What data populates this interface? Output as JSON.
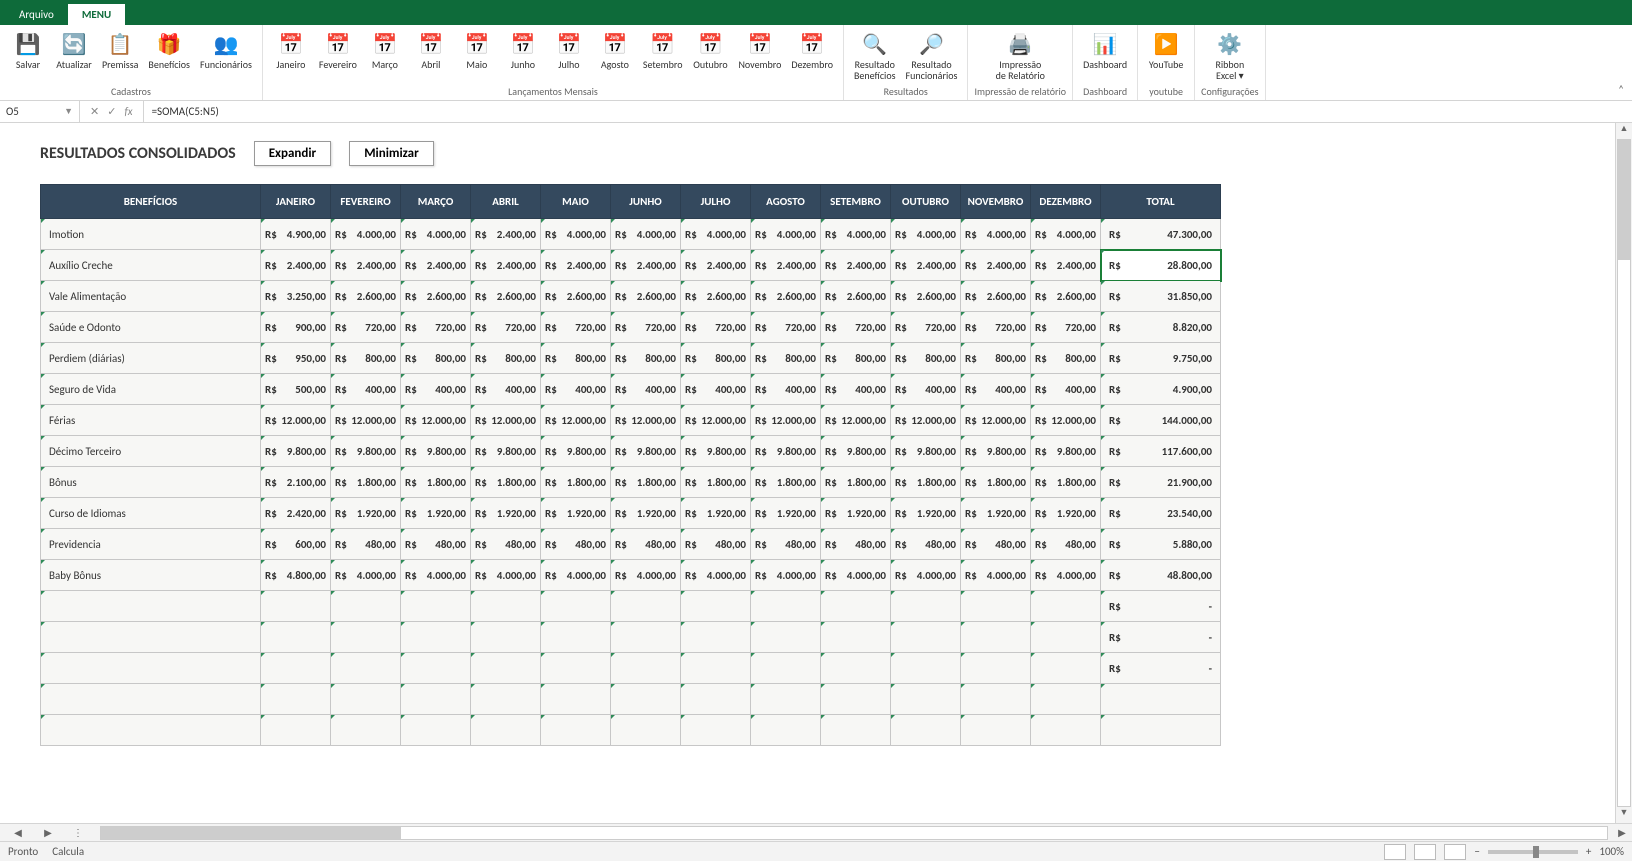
{
  "tabs": {
    "file": "Arquivo",
    "menu": "MENU"
  },
  "ribbon": {
    "groups": [
      {
        "label": "Cadastros",
        "buttons": [
          {
            "name": "salvar-button",
            "icon": "💾",
            "label": "Salvar"
          },
          {
            "name": "atualizar-button",
            "icon": "🔄",
            "label": "Atualizar"
          },
          {
            "name": "premissa-button",
            "icon": "📋",
            "label": "Premissa"
          },
          {
            "name": "beneficios-button",
            "icon": "🎁",
            "label": "Benefícios"
          },
          {
            "name": "funcionarios-button",
            "icon": "👥",
            "label": "Funcionários"
          }
        ]
      },
      {
        "label": "Lançamentos Mensais",
        "buttons": [
          {
            "name": "mes-janeiro",
            "icon": "📅",
            "label": "Janeiro"
          },
          {
            "name": "mes-fevereiro",
            "icon": "📅",
            "label": "Fevereiro"
          },
          {
            "name": "mes-marco",
            "icon": "📅",
            "label": "Março"
          },
          {
            "name": "mes-abril",
            "icon": "📅",
            "label": "Abril"
          },
          {
            "name": "mes-maio",
            "icon": "📅",
            "label": "Maio"
          },
          {
            "name": "mes-junho",
            "icon": "📅",
            "label": "Junho"
          },
          {
            "name": "mes-julho",
            "icon": "📅",
            "label": "Julho"
          },
          {
            "name": "mes-agosto",
            "icon": "📅",
            "label": "Agosto"
          },
          {
            "name": "mes-setembro",
            "icon": "📅",
            "label": "Setembro"
          },
          {
            "name": "mes-outubro",
            "icon": "📅",
            "label": "Outubro"
          },
          {
            "name": "mes-novembro",
            "icon": "📅",
            "label": "Novembro"
          },
          {
            "name": "mes-dezembro",
            "icon": "📅",
            "label": "Dezembro"
          }
        ]
      },
      {
        "label": "Resultados",
        "buttons": [
          {
            "name": "res-beneficios",
            "icon": "🔍",
            "label": "Resultado\nBenefícios"
          },
          {
            "name": "res-funcionarios",
            "icon": "🔎",
            "label": "Resultado\nFuncionários"
          }
        ]
      },
      {
        "label": "Impressão de relatório",
        "buttons": [
          {
            "name": "impressao",
            "icon": "🖨️",
            "label": "Impressão\nde Relatório"
          }
        ]
      },
      {
        "label": "Dashboard",
        "buttons": [
          {
            "name": "dashboard",
            "icon": "📊",
            "label": "Dashboard"
          }
        ]
      },
      {
        "label": "youtube",
        "buttons": [
          {
            "name": "youtube",
            "icon": "▶️",
            "label": "YouTube"
          }
        ]
      },
      {
        "label": "Configurações",
        "buttons": [
          {
            "name": "ribbon-excel",
            "icon": "⚙️",
            "label": "Ribbon\nExcel ▾"
          }
        ]
      }
    ]
  },
  "formula_bar": {
    "name_box": "O5",
    "formula": "=SOMA(C5:N5)"
  },
  "page": {
    "title": "RESULTADOS CONSOLIDADOS",
    "expand": "Expandir",
    "minimize": "Minimizar"
  },
  "table": {
    "currency": "R$",
    "headers": [
      "BENEFÍCIOS",
      "JANEIRO",
      "FEVEREIRO",
      "MARÇO",
      "ABRIL",
      "MAIO",
      "JUNHO",
      "JULHO",
      "AGOSTO",
      "SETEMBRO",
      "OUTUBRO",
      "NOVEMBRO",
      "DEZEMBRO",
      "TOTAL"
    ],
    "rows": [
      {
        "name": "Imotion",
        "m": [
          "4.900,00",
          "4.000,00",
          "4.000,00",
          "2.400,00",
          "4.000,00",
          "4.000,00",
          "4.000,00",
          "4.000,00",
          "4.000,00",
          "4.000,00",
          "4.000,00",
          "4.000,00"
        ],
        "total": "47.300,00"
      },
      {
        "name": "Auxílio Creche",
        "m": [
          "2.400,00",
          "2.400,00",
          "2.400,00",
          "2.400,00",
          "2.400,00",
          "2.400,00",
          "2.400,00",
          "2.400,00",
          "2.400,00",
          "2.400,00",
          "2.400,00",
          "2.400,00"
        ],
        "total": "28.800,00",
        "selected": true
      },
      {
        "name": "Vale Alimentação",
        "m": [
          "3.250,00",
          "2.600,00",
          "2.600,00",
          "2.600,00",
          "2.600,00",
          "2.600,00",
          "2.600,00",
          "2.600,00",
          "2.600,00",
          "2.600,00",
          "2.600,00",
          "2.600,00"
        ],
        "total": "31.850,00"
      },
      {
        "name": "Saúde e Odonto",
        "m": [
          "900,00",
          "720,00",
          "720,00",
          "720,00",
          "720,00",
          "720,00",
          "720,00",
          "720,00",
          "720,00",
          "720,00",
          "720,00",
          "720,00"
        ],
        "total": "8.820,00"
      },
      {
        "name": "Perdiem (diárias)",
        "m": [
          "950,00",
          "800,00",
          "800,00",
          "800,00",
          "800,00",
          "800,00",
          "800,00",
          "800,00",
          "800,00",
          "800,00",
          "800,00",
          "800,00"
        ],
        "total": "9.750,00"
      },
      {
        "name": "Seguro de Vida",
        "m": [
          "500,00",
          "400,00",
          "400,00",
          "400,00",
          "400,00",
          "400,00",
          "400,00",
          "400,00",
          "400,00",
          "400,00",
          "400,00",
          "400,00"
        ],
        "total": "4.900,00"
      },
      {
        "name": "Férias",
        "m": [
          "12.000,00",
          "12.000,00",
          "12.000,00",
          "12.000,00",
          "12.000,00",
          "12.000,00",
          "12.000,00",
          "12.000,00",
          "12.000,00",
          "12.000,00",
          "12.000,00",
          "12.000,00"
        ],
        "total": "144.000,00"
      },
      {
        "name": "Décimo Terceiro",
        "m": [
          "9.800,00",
          "9.800,00",
          "9.800,00",
          "9.800,00",
          "9.800,00",
          "9.800,00",
          "9.800,00",
          "9.800,00",
          "9.800,00",
          "9.800,00",
          "9.800,00",
          "9.800,00"
        ],
        "total": "117.600,00"
      },
      {
        "name": "Bônus",
        "m": [
          "2.100,00",
          "1.800,00",
          "1.800,00",
          "1.800,00",
          "1.800,00",
          "1.800,00",
          "1.800,00",
          "1.800,00",
          "1.800,00",
          "1.800,00",
          "1.800,00",
          "1.800,00"
        ],
        "total": "21.900,00"
      },
      {
        "name": "Curso de Idiomas",
        "m": [
          "2.420,00",
          "1.920,00",
          "1.920,00",
          "1.920,00",
          "1.920,00",
          "1.920,00",
          "1.920,00",
          "1.920,00",
          "1.920,00",
          "1.920,00",
          "1.920,00",
          "1.920,00"
        ],
        "total": "23.540,00"
      },
      {
        "name": "Previdencia",
        "m": [
          "600,00",
          "480,00",
          "480,00",
          "480,00",
          "480,00",
          "480,00",
          "480,00",
          "480,00",
          "480,00",
          "480,00",
          "480,00",
          "480,00"
        ],
        "total": "5.880,00"
      },
      {
        "name": "Baby Bônus",
        "m": [
          "4.800,00",
          "4.000,00",
          "4.000,00",
          "4.000,00",
          "4.000,00",
          "4.000,00",
          "4.000,00",
          "4.000,00",
          "4.000,00",
          "4.000,00",
          "4.000,00",
          "4.000,00"
        ],
        "total": "48.800,00"
      },
      {
        "name": "",
        "m": [
          "",
          "",
          "",
          "",
          "",
          "",
          "",
          "",
          "",
          "",
          "",
          ""
        ],
        "total": "-"
      },
      {
        "name": "",
        "m": [
          "",
          "",
          "",
          "",
          "",
          "",
          "",
          "",
          "",
          "",
          "",
          ""
        ],
        "total": "-"
      },
      {
        "name": "",
        "m": [
          "",
          "",
          "",
          "",
          "",
          "",
          "",
          "",
          "",
          "",
          "",
          ""
        ],
        "total": "-"
      },
      {
        "name": "",
        "m": [
          "",
          "",
          "",
          "",
          "",
          "",
          "",
          "",
          "",
          "",
          "",
          ""
        ],
        "total": ""
      },
      {
        "name": "",
        "m": [
          "",
          "",
          "",
          "",
          "",
          "",
          "",
          "",
          "",
          "",
          "",
          ""
        ],
        "total": ""
      }
    ]
  },
  "status": {
    "ready": "Pronto",
    "calc": "Calcula",
    "zoom": "100%"
  }
}
